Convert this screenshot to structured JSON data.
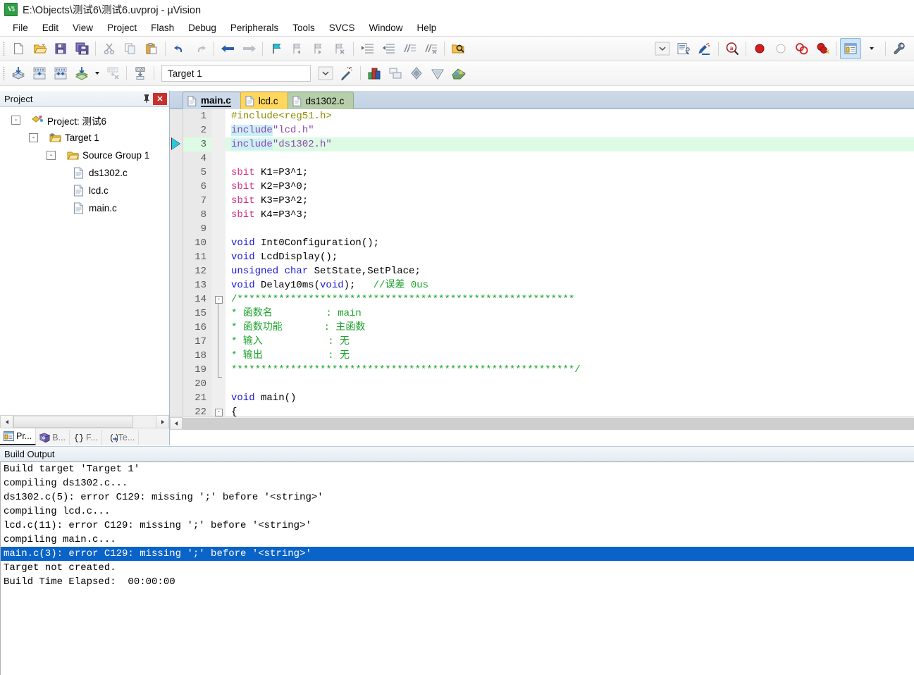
{
  "window": {
    "title": "E:\\Objects\\测试6\\测试6.uvproj - µVision",
    "app_icon": "uvision-logo-icon"
  },
  "menubar": {
    "items": [
      {
        "label": "File"
      },
      {
        "label": "Edit"
      },
      {
        "label": "View"
      },
      {
        "label": "Project"
      },
      {
        "label": "Flash"
      },
      {
        "label": "Debug"
      },
      {
        "label": "Peripherals"
      },
      {
        "label": "Tools"
      },
      {
        "label": "SVCS"
      },
      {
        "label": "Window"
      },
      {
        "label": "Help"
      }
    ]
  },
  "toolbar_main": {
    "buttons": [
      {
        "name": "new-file-icon"
      },
      {
        "name": "open-file-icon"
      },
      {
        "name": "save-icon"
      },
      {
        "name": "save-all-icon"
      },
      {
        "name": "cut-icon"
      },
      {
        "name": "copy-icon"
      },
      {
        "name": "paste-icon"
      },
      {
        "name": "undo-icon"
      },
      {
        "name": "redo-icon"
      },
      {
        "name": "navigate-back-icon"
      },
      {
        "name": "navigate-forward-icon"
      },
      {
        "name": "bookmark-toggle-icon"
      },
      {
        "name": "bookmark-prev-icon"
      },
      {
        "name": "bookmark-next-icon"
      },
      {
        "name": "bookmark-clear-icon"
      },
      {
        "name": "indent-right-icon"
      },
      {
        "name": "indent-left-icon"
      },
      {
        "name": "comment-lines-icon"
      },
      {
        "name": "uncomment-lines-icon"
      },
      {
        "name": "find-in-files-icon"
      },
      {
        "name": "dropdown-arrow-icon"
      },
      {
        "name": "configure-debug-icon"
      },
      {
        "name": "insert-bookmark-icon"
      },
      {
        "name": "find-icon"
      },
      {
        "name": "breakpoint-insert-icon"
      },
      {
        "name": "breakpoint-disable-icon"
      },
      {
        "name": "breakpoint-kill-all-icon"
      },
      {
        "name": "breakpoint-disable-all-icon"
      },
      {
        "name": "manage-windows-icon"
      },
      {
        "name": "dropdown-arrow-icon"
      },
      {
        "name": "configure-toolbar-icon"
      }
    ]
  },
  "toolbar_build": {
    "buttons": [
      {
        "name": "translate-file-icon"
      },
      {
        "name": "build-target-icon"
      },
      {
        "name": "rebuild-all-icon"
      },
      {
        "name": "batch-build-icon"
      },
      {
        "name": "batch-build-dropdown-icon"
      },
      {
        "name": "stop-build-icon"
      },
      {
        "name": "download-to-flash-icon"
      },
      {
        "name": "magic-wand-icon"
      },
      {
        "name": "target-options-icon"
      },
      {
        "name": "manage-components-icon"
      },
      {
        "name": "svcs-commit-icon"
      },
      {
        "name": "svcs-update-icon"
      },
      {
        "name": "pack-installer-icon"
      }
    ],
    "target_combo": {
      "value": "Target 1",
      "placeholder": "Target"
    }
  },
  "project_panel": {
    "title": "Project",
    "pin_icon": "pin-icon",
    "close_icon": "close-icon",
    "tree": [
      {
        "label": "Project: 测试6",
        "depth": 0,
        "icon": "project-icon",
        "toggle": "-"
      },
      {
        "label": "Target 1",
        "depth": 1,
        "icon": "target-icon",
        "toggle": "-"
      },
      {
        "label": "Source Group 1",
        "depth": 2,
        "icon": "folder-icon",
        "toggle": "-"
      },
      {
        "label": "ds1302.c",
        "depth": 3,
        "icon": "c-file-icon",
        "toggle": ""
      },
      {
        "label": "lcd.c",
        "depth": 3,
        "icon": "c-file-icon",
        "toggle": ""
      },
      {
        "label": "main.c",
        "depth": 3,
        "icon": "c-file-icon",
        "toggle": ""
      }
    ],
    "bottom_tabs": [
      {
        "label": "Pr...",
        "icon": "project-tab-icon",
        "selected": true
      },
      {
        "label": "B...",
        "icon": "books-tab-icon",
        "selected": false
      },
      {
        "label": "F...",
        "icon": "functions-tab-icon",
        "selected": false
      },
      {
        "label": "Te...",
        "icon": "templates-tab-icon",
        "selected": false
      }
    ]
  },
  "editor": {
    "tabs": [
      {
        "label": "main.c",
        "active": true,
        "color": "#ccd9e8"
      },
      {
        "label": "lcd.c",
        "active": false,
        "color": "#ffd75e"
      },
      {
        "label": "ds1302.c",
        "active": false,
        "color": "#b6ceaa"
      }
    ],
    "current_line_marker_line": 3,
    "highlight_line": 3,
    "lines": [
      {
        "n": "1",
        "html": "<span class=\"pp\">#include&lt;reg51.h&gt;</span>"
      },
      {
        "n": "2",
        "html": "<span class=\"str find\">include</span><span class=\"str\">\"lcd.h\"</span>"
      },
      {
        "n": "3",
        "html": "<span class=\"str find\">include</span><span class=\"str\">\"ds1302.h\"</span>"
      },
      {
        "n": "4",
        "html": ""
      },
      {
        "n": "5",
        "html": "<span class=\"sb\">sbit</span><span class=\"tx\"> K1=P3^1;</span>"
      },
      {
        "n": "6",
        "html": "<span class=\"sb\">sbit</span><span class=\"tx\"> K2=P3^0;</span>"
      },
      {
        "n": "7",
        "html": "<span class=\"sb\">sbit</span><span class=\"tx\"> K3=P3^2;</span>"
      },
      {
        "n": "8",
        "html": "<span class=\"sb\">sbit</span><span class=\"tx\"> K4=P3^3;</span>"
      },
      {
        "n": "9",
        "html": ""
      },
      {
        "n": "10",
        "html": "<span class=\"k\">void</span><span class=\"tx\"> Int0Configuration();</span>"
      },
      {
        "n": "11",
        "html": "<span class=\"k\">void</span><span class=\"tx\"> LcdDisplay();</span>"
      },
      {
        "n": "12",
        "html": "<span class=\"k\">unsigned char</span><span class=\"tx\"> SetState,SetPlace;</span>"
      },
      {
        "n": "13",
        "html": "<span class=\"k\">void</span><span class=\"tx\"> Delay10ms(</span><span class=\"k\">void</span><span class=\"tx\">);   </span><span class=\"cm\">//误差 0us</span>"
      },
      {
        "n": "14",
        "html": "<span class=\"cm\">/*********************************************************</span>"
      },
      {
        "n": "15",
        "html": "<span class=\"cm\">* 函数名         : main</span>"
      },
      {
        "n": "16",
        "html": "<span class=\"cm\">* 函数功能       : 主函数</span>"
      },
      {
        "n": "17",
        "html": "<span class=\"cm\">* 输入           : 无</span>"
      },
      {
        "n": "18",
        "html": "<span class=\"cm\">* 输出           : 无</span>"
      },
      {
        "n": "19",
        "html": "<span class=\"cm\">**********************************************************/</span>"
      },
      {
        "n": "20",
        "html": ""
      },
      {
        "n": "21",
        "html": "<span class=\"k\">void</span><span class=\"tx\"> main()</span>"
      },
      {
        "n": "22",
        "html": "<span class=\"tx\">{</span>"
      }
    ]
  },
  "build_output": {
    "title": "Build Output",
    "lines": [
      {
        "text": "Build target 'Target 1'",
        "selected": false
      },
      {
        "text": "compiling ds1302.c...",
        "selected": false
      },
      {
        "text": "ds1302.c(5): error C129: missing ';' before '<string>'",
        "selected": false
      },
      {
        "text": "compiling lcd.c...",
        "selected": false
      },
      {
        "text": "lcd.c(11): error C129: missing ';' before '<string>'",
        "selected": false
      },
      {
        "text": "compiling main.c...",
        "selected": false
      },
      {
        "text": "main.c(3): error C129: missing ';' before '<string>'",
        "selected": true
      },
      {
        "text": "Target not created.",
        "selected": false
      },
      {
        "text": "Build Time Elapsed:  00:00:00",
        "selected": false
      }
    ]
  },
  "colors": {
    "selection_blue": "#0a63c8",
    "highlight_green": "#ddfbe4",
    "find_match": "#cbf1f7",
    "tab_active": "#ccd9e8",
    "tab_lcd": "#ffd75e",
    "tab_ds1302": "#b6ceaa",
    "close_red": "#c9302c"
  }
}
